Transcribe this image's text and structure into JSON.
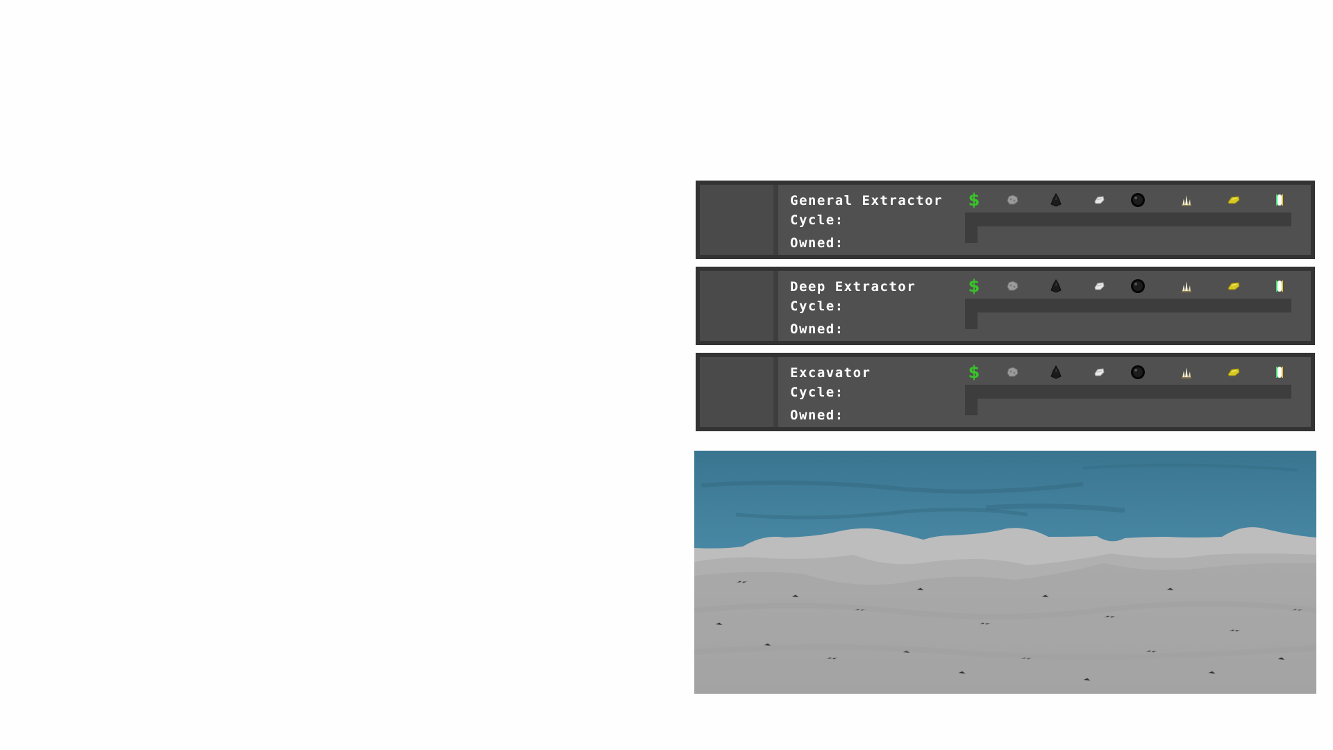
{
  "colors": {
    "panel_border": "#333333",
    "panel_body": "#505050",
    "money": "#39c22a",
    "water": "#3f7d98",
    "ground": "#a5a5a5"
  },
  "resources": [
    {
      "icon": "money-icon",
      "glyph": "$"
    },
    {
      "icon": "stone-icon"
    },
    {
      "icon": "coal-icon"
    },
    {
      "icon": "iron-ore-icon"
    },
    {
      "icon": "dark-orb-icon"
    },
    {
      "icon": "quartz-crystal-icon"
    },
    {
      "icon": "gold-ore-icon"
    },
    {
      "icon": "gem-crystal-icon"
    }
  ],
  "extractors": [
    {
      "name": "General Extractor",
      "cycle_label": "Cycle:",
      "owned_label": "Owned:",
      "cycle_progress": 0
    },
    {
      "name": "Deep Extractor",
      "cycle_label": "Cycle:",
      "owned_label": "Owned:",
      "cycle_progress": 0
    },
    {
      "name": "Excavator",
      "cycle_label": "Cycle:",
      "owned_label": "Owned:",
      "cycle_progress": 0
    }
  ]
}
